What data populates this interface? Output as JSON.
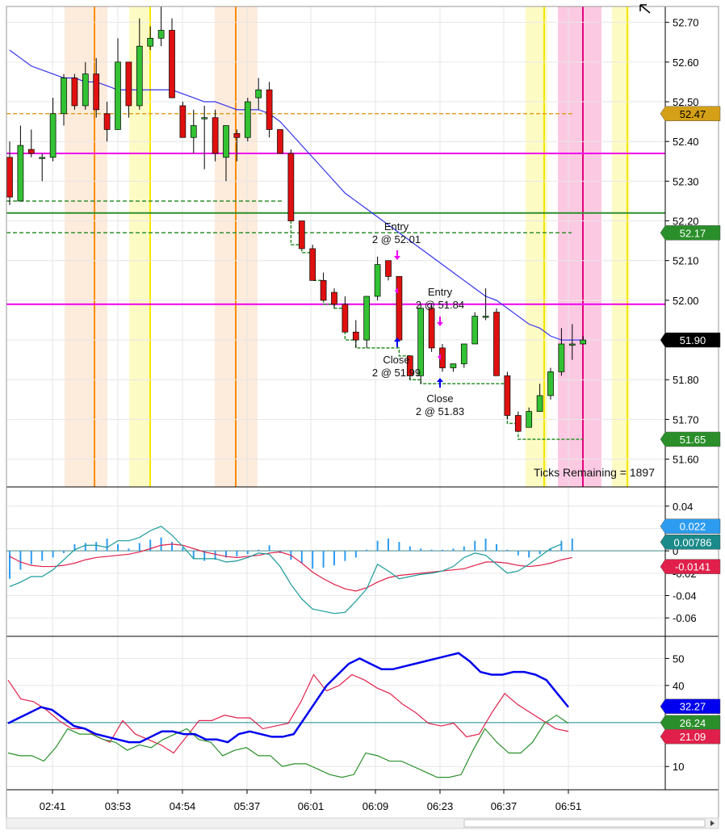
{
  "chart_data": {
    "type": "candlestick",
    "x_ticks": [
      "02:41",
      "03:53",
      "04:54",
      "05:37",
      "06:01",
      "06:09",
      "06:23",
      "06:37",
      "06:51"
    ],
    "price_panel": {
      "ylim": [
        51.53,
        52.74
      ],
      "y_ticks": [
        "52.70",
        "52.60",
        "52.50",
        "52.40",
        "52.30",
        "52.20",
        "52.10",
        "52.00",
        "51.90",
        "51.80",
        "51.70",
        "51.60"
      ],
      "candles": [
        {
          "o": 52.36,
          "h": 52.4,
          "l": 52.24,
          "c": 52.26
        },
        {
          "o": 52.25,
          "h": 52.44,
          "l": 52.25,
          "c": 52.39
        },
        {
          "o": 52.38,
          "h": 52.43,
          "l": 52.36,
          "c": 52.37
        },
        {
          "o": 52.36,
          "h": 52.37,
          "l": 52.3,
          "c": 52.36
        },
        {
          "o": 52.36,
          "h": 52.51,
          "l": 52.35,
          "c": 52.47
        },
        {
          "o": 52.47,
          "h": 52.57,
          "l": 52.44,
          "c": 52.56
        },
        {
          "o": 52.56,
          "h": 52.57,
          "l": 52.48,
          "c": 52.49
        },
        {
          "o": 52.49,
          "h": 52.6,
          "l": 52.48,
          "c": 52.57
        },
        {
          "o": 52.57,
          "h": 52.61,
          "l": 52.46,
          "c": 52.48
        },
        {
          "o": 52.47,
          "h": 52.5,
          "l": 52.4,
          "c": 52.43
        },
        {
          "o": 52.43,
          "h": 52.66,
          "l": 52.43,
          "c": 52.6
        },
        {
          "o": 52.6,
          "h": 52.6,
          "l": 52.46,
          "c": 52.49
        },
        {
          "o": 52.49,
          "h": 52.71,
          "l": 52.48,
          "c": 52.64
        },
        {
          "o": 52.64,
          "h": 52.69,
          "l": 52.63,
          "c": 52.66
        },
        {
          "o": 52.66,
          "h": 52.74,
          "l": 52.64,
          "c": 52.68
        },
        {
          "o": 52.68,
          "h": 52.71,
          "l": 52.51,
          "c": 52.51
        },
        {
          "o": 52.49,
          "h": 52.5,
          "l": 52.41,
          "c": 52.41
        },
        {
          "o": 52.41,
          "h": 52.48,
          "l": 52.37,
          "c": 52.44
        },
        {
          "o": 52.46,
          "h": 52.49,
          "l": 52.33,
          "c": 52.46
        },
        {
          "o": 52.46,
          "h": 52.48,
          "l": 52.35,
          "c": 52.37
        },
        {
          "o": 52.36,
          "h": 52.44,
          "l": 52.3,
          "c": 52.44
        },
        {
          "o": 52.42,
          "h": 52.43,
          "l": 52.35,
          "c": 52.41
        },
        {
          "o": 52.41,
          "h": 52.51,
          "l": 52.4,
          "c": 52.5
        },
        {
          "o": 52.51,
          "h": 52.56,
          "l": 52.48,
          "c": 52.53
        },
        {
          "o": 52.53,
          "h": 52.55,
          "l": 52.41,
          "c": 52.43
        },
        {
          "o": 52.43,
          "h": 52.43,
          "l": 52.37,
          "c": 52.37
        },
        {
          "o": 52.37,
          "h": 52.38,
          "l": 52.2,
          "c": 52.2
        },
        {
          "o": 52.2,
          "h": 52.2,
          "l": 52.13,
          "c": 52.13
        },
        {
          "o": 52.13,
          "h": 52.14,
          "l": 52.05,
          "c": 52.05
        },
        {
          "o": 52.05,
          "h": 52.07,
          "l": 52.0,
          "c": 52.0
        },
        {
          "o": 52.02,
          "h": 52.03,
          "l": 51.98,
          "c": 51.99
        },
        {
          "o": 51.99,
          "h": 52.01,
          "l": 51.92,
          "c": 51.92
        },
        {
          "o": 51.92,
          "h": 51.95,
          "l": 51.88,
          "c": 51.9
        },
        {
          "o": 51.9,
          "h": 52.01,
          "l": 51.88,
          "c": 52.01
        },
        {
          "o": 52.01,
          "h": 52.11,
          "l": 52.0,
          "c": 52.09
        },
        {
          "o": 52.1,
          "h": 52.1,
          "l": 52.05,
          "c": 52.06
        },
        {
          "o": 52.06,
          "h": 52.06,
          "l": 51.9,
          "c": 51.9
        },
        {
          "o": 51.86,
          "h": 51.86,
          "l": 51.8,
          "c": 51.81
        },
        {
          "o": 51.81,
          "h": 51.99,
          "l": 51.79,
          "c": 51.98
        },
        {
          "o": 51.98,
          "h": 51.99,
          "l": 51.87,
          "c": 51.88
        },
        {
          "o": 51.88,
          "h": 51.89,
          "l": 51.82,
          "c": 51.83
        },
        {
          "o": 51.83,
          "h": 51.84,
          "l": 51.82,
          "c": 51.84
        },
        {
          "o": 51.84,
          "h": 51.89,
          "l": 51.83,
          "c": 51.89
        },
        {
          "o": 51.89,
          "h": 51.97,
          "l": 51.89,
          "c": 51.96
        },
        {
          "o": 51.96,
          "h": 52.03,
          "l": 51.95,
          "c": 51.96
        },
        {
          "o": 51.97,
          "h": 51.98,
          "l": 51.81,
          "c": 51.81
        },
        {
          "o": 51.81,
          "h": 51.82,
          "l": 51.7,
          "c": 51.71
        },
        {
          "o": 51.71,
          "h": 51.72,
          "l": 51.67,
          "c": 51.67
        },
        {
          "o": 51.68,
          "h": 51.73,
          "l": 51.68,
          "c": 51.72
        },
        {
          "o": 51.72,
          "h": 51.79,
          "l": 51.72,
          "c": 51.76
        },
        {
          "o": 51.76,
          "h": 51.83,
          "l": 51.75,
          "c": 51.82
        },
        {
          "o": 51.82,
          "h": 51.93,
          "l": 51.81,
          "c": 51.89
        },
        {
          "o": 51.89,
          "h": 51.94,
          "l": 51.85,
          "c": 51.89
        },
        {
          "o": 51.89,
          "h": 51.91,
          "l": 51.89,
          "c": 51.9
        }
      ],
      "moving_average": [
        52.63,
        52.61,
        52.59,
        52.58,
        52.57,
        52.56,
        52.56,
        52.55,
        52.55,
        52.54,
        52.53,
        52.53,
        52.53,
        52.53,
        52.53,
        52.53,
        52.52,
        52.51,
        52.5,
        52.5,
        52.49,
        52.48,
        52.48,
        52.48,
        52.47,
        52.45,
        52.42,
        52.39,
        52.36,
        52.33,
        52.3,
        52.27,
        52.25,
        52.23,
        52.21,
        52.19,
        52.17,
        52.15,
        52.13,
        52.11,
        52.09,
        52.07,
        52.05,
        52.03,
        52.01,
        52.0,
        51.98,
        51.96,
        51.94,
        51.93,
        51.91,
        51.9,
        51.9,
        51.9
      ],
      "horizontal_lines": [
        {
          "value": 52.47,
          "style": "dashed",
          "color": "#e0a020"
        },
        {
          "value": 52.37,
          "style": "solid",
          "color": "#ee00ee"
        },
        {
          "value": 52.25,
          "style": "dashed",
          "color": "#2f8f2f"
        },
        {
          "value": 52.22,
          "style": "solid",
          "color": "#2f8f2f"
        },
        {
          "value": 52.17,
          "style": "dashed",
          "color": "#2f8f2f"
        },
        {
          "value": 51.99,
          "style": "solid",
          "color": "#ee00ee"
        }
      ],
      "trailing_stop": [
        52.25,
        52.25,
        52.25,
        52.25,
        52.25,
        52.25,
        52.25,
        52.25,
        52.25,
        52.25,
        52.25,
        52.25,
        52.25,
        52.25,
        52.25,
        52.25,
        52.25,
        52.25,
        52.25,
        52.25,
        52.25,
        52.25,
        52.25,
        52.25,
        52.25,
        52.25,
        52.25,
        52.14,
        52.12,
        52.05,
        51.99,
        51.98,
        51.9,
        51.88,
        51.88,
        51.88,
        51.88,
        51.86,
        51.8,
        51.79,
        51.79,
        51.79,
        51.79,
        51.79,
        51.79,
        51.79,
        51.79,
        51.69,
        51.65,
        51.65,
        51.65,
        51.65,
        51.65,
        51.65
      ],
      "price_labels": [
        {
          "text": "52.47",
          "value": 52.47,
          "color": "#d4a017",
          "text_color": "#000000"
        },
        {
          "text": "52.17",
          "value": 52.17,
          "color": "#2a8f2a",
          "text_color": "#ffffff"
        },
        {
          "text": "51.90",
          "value": 51.9,
          "color": "#000000",
          "text_color": "#ffffff"
        },
        {
          "text": "51.65",
          "value": 51.65,
          "color": "#2a8f2a",
          "text_color": "#ffffff"
        }
      ],
      "annotations": [
        {
          "line1": "Entry",
          "line2": "2 @ 52.01"
        },
        {
          "line1": "Entry",
          "line2": "2 @ 51.84"
        },
        {
          "line1": "Close",
          "line2": "2 @ 51.99"
        },
        {
          "line1": "Close",
          "line2": "2 @ 51.83"
        }
      ],
      "status_text": "Ticks Remaining = 1897"
    },
    "oscillator_panel": {
      "ylim": [
        -0.075,
        0.055
      ],
      "y_ticks": [
        "0.04",
        "0.02",
        "0",
        "-0.02",
        "-0.04",
        "-0.06"
      ],
      "histogram": [
        -0.025,
        -0.017,
        -0.012,
        -0.009,
        -0.006,
        -0.002,
        0.006,
        0.007,
        0.008,
        0.011,
        0.006,
        0.002,
        0.007,
        0.01,
        0.012,
        0.008,
        0.003,
        -0.007,
        -0.009,
        -0.008,
        -0.006,
        -0.005,
        -0.003,
        0.001,
        0.005,
        -0.002,
        -0.008,
        -0.011,
        -0.016,
        -0.015,
        -0.013,
        -0.009,
        -0.006,
        0.001,
        0.009,
        0.011,
        0.008,
        0.004,
        0.002,
        0.001,
        0.001,
        0.002,
        0.004,
        0.009,
        0.011,
        0.006,
        0.001,
        -0.004,
        -0.006,
        -0.003,
        0.002,
        0.009,
        0.011
      ],
      "signal_line": [
        -0.005,
        -0.01,
        -0.013,
        -0.014,
        -0.014,
        -0.013,
        -0.011,
        -0.008,
        -0.006,
        -0.005,
        -0.004,
        -0.003,
        -0.001,
        0.002,
        0.005,
        0.006,
        0.005,
        0.002,
        -0.001,
        -0.003,
        -0.005,
        -0.006,
        -0.005,
        -0.004,
        -0.002,
        -0.001,
        -0.004,
        -0.011,
        -0.019,
        -0.025,
        -0.03,
        -0.034,
        -0.036,
        -0.033,
        -0.028,
        -0.024,
        -0.022,
        -0.021,
        -0.02,
        -0.019,
        -0.018,
        -0.017,
        -0.016,
        -0.013,
        -0.01,
        -0.01,
        -0.011,
        -0.013,
        -0.014,
        -0.013,
        -0.011,
        -0.008,
        -0.006
      ],
      "macd_line": [
        -0.032,
        -0.028,
        -0.023,
        -0.023,
        -0.017,
        -0.008,
        0.001,
        0.005,
        0.005,
        0.003,
        0.009,
        0.009,
        0.012,
        0.018,
        0.022,
        0.014,
        0.004,
        -0.007,
        -0.007,
        -0.007,
        -0.01,
        -0.009,
        -0.006,
        -0.002,
        -0.003,
        -0.014,
        -0.03,
        -0.043,
        -0.052,
        -0.054,
        -0.056,
        -0.055,
        -0.045,
        -0.034,
        -0.012,
        -0.018,
        -0.025,
        -0.023,
        -0.021,
        -0.02,
        -0.018,
        -0.014,
        -0.006,
        -0.002,
        -0.004,
        -0.012,
        -0.02,
        -0.018,
        -0.012,
        -0.005,
        0.002,
        0.006
      ],
      "labels": [
        {
          "text": "0.022",
          "value": 0.022,
          "color": "#2d9cf0",
          "text_color": "#ffffff"
        },
        {
          "text": "0.00786",
          "value": 0.00786,
          "color": "#1a8a8a",
          "text_color": "#ffffff"
        },
        {
          "text": "-0.0141",
          "value": -0.0141,
          "color": "#e0204a",
          "text_color": "#ffffff"
        }
      ]
    },
    "dmi_panel": {
      "ylim": [
        2,
        57
      ],
      "y_ticks": [
        "50",
        "40",
        "10"
      ],
      "reference_line": 26.24,
      "adx": [
        26,
        28,
        30,
        32,
        31,
        28,
        25,
        24,
        22,
        21,
        20,
        19,
        19,
        21,
        23,
        23,
        22,
        22,
        20,
        20,
        19,
        22,
        23,
        22,
        21,
        21,
        22,
        28,
        34,
        40,
        44,
        48,
        50,
        48,
        46,
        46,
        47,
        48,
        49,
        50,
        51,
        52,
        49,
        45,
        44,
        44,
        45,
        45,
        44,
        42,
        37,
        32
      ],
      "di_plus": [
        42,
        35,
        34,
        31,
        27,
        24,
        24,
        21,
        19,
        27,
        22,
        20,
        18,
        15,
        21,
        27,
        27,
        29,
        28,
        28,
        24,
        25,
        26,
        34,
        44,
        38,
        40,
        44,
        42,
        39,
        37,
        33,
        30,
        26,
        25,
        26,
        21,
        22,
        30,
        37,
        33,
        30,
        27,
        24,
        23
      ],
      "di_minus": [
        15,
        14,
        14,
        12,
        17,
        24,
        22,
        22,
        20,
        19,
        16,
        18,
        17,
        20,
        22,
        24,
        20,
        19,
        14,
        16,
        17,
        14,
        14,
        10,
        11,
        11,
        9,
        7,
        6,
        7,
        15,
        14,
        12,
        12,
        10,
        8,
        6,
        6,
        7,
        16,
        24,
        19,
        15,
        15,
        19,
        26,
        29,
        26
      ],
      "labels": [
        {
          "text": "32.27",
          "value": 32.27,
          "color": "#0000ee",
          "text_color": "#ffffff"
        },
        {
          "text": "26.24",
          "value": 26.24,
          "color": "#2a8f2a",
          "text_color": "#ffffff"
        },
        {
          "text": "21.09",
          "value": 21.09,
          "color": "#e0204a",
          "text_color": "#ffffff"
        }
      ]
    }
  }
}
